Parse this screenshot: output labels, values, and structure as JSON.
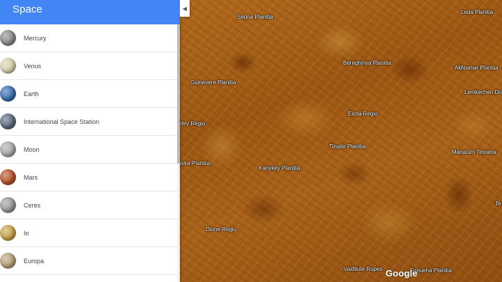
{
  "sidebar": {
    "title": "Space",
    "items": [
      {
        "label": "Mercury",
        "color": "#8a8a8a"
      },
      {
        "label": "Venus",
        "color": "#d8cfae"
      },
      {
        "label": "Earth",
        "color": "#3a6fb0"
      },
      {
        "label": "International Space Station",
        "color": "#5a6b80"
      },
      {
        "label": "Moon",
        "color": "#a9a9a9"
      },
      {
        "label": "Mars",
        "color": "#b5522a"
      },
      {
        "label": "Ceres",
        "color": "#9a9a9a"
      },
      {
        "label": "Io",
        "color": "#c9a24a"
      },
      {
        "label": "Europa",
        "color": "#b7a07a"
      }
    ]
  },
  "collapse_icon": "chevron-left-icon",
  "map": {
    "labels": [
      "Sedna Planitia",
      "Leda Planitia",
      "Bereghinya Planitia",
      "Akhtamar Planitia",
      "Guinevere Planitia",
      "Lemkechen Dorsa",
      "Eistla Regio",
      "Tefey Regio",
      "Tinatin Planitia",
      "Manatum Tessera",
      "Kanykey Planitia",
      "Navka Planitia",
      "Dione Regio",
      "Vaidilute Rupes",
      "Fonueha Planitia",
      "Te"
    ],
    "logo": "Google"
  }
}
